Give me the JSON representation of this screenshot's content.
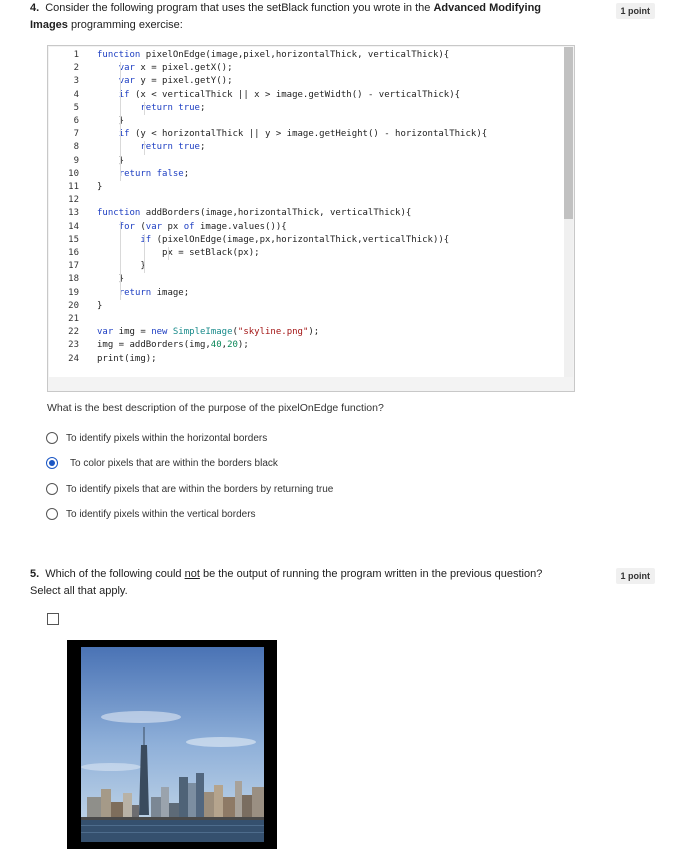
{
  "q4": {
    "number": "4.",
    "text_a": "Consider the following program that uses the setBlack function you wrote in the ",
    "text_bold": "Advanced Modifying Images",
    "text_b": " programming exercise:",
    "points": "1 point",
    "prompt": "What is the best description of the purpose of the pixelOnEdge function?",
    "options": [
      {
        "label": "To identify pixels within the horizontal borders",
        "selected": false
      },
      {
        "label": "To color pixels that are within the borders black",
        "selected": true
      },
      {
        "label": "To identify pixels that are within the borders by returning true",
        "selected": false
      },
      {
        "label": "To identify pixels within the vertical borders",
        "selected": false
      }
    ]
  },
  "code_lines": [
    {
      "n": "1",
      "t": "function pixelOnEdge(image,pixel,horizontalThick, verticalThick){"
    },
    {
      "n": "2",
      "t": "    var x = pixel.getX();"
    },
    {
      "n": "3",
      "t": "    var y = pixel.getY();"
    },
    {
      "n": "4",
      "t": "    if (x < verticalThick || x > image.getWidth() - verticalThick){"
    },
    {
      "n": "5",
      "t": "        return true;"
    },
    {
      "n": "6",
      "t": "    }"
    },
    {
      "n": "7",
      "t": "    if (y < horizontalThick || y > image.getHeight() - horizontalThick){"
    },
    {
      "n": "8",
      "t": "        return true;"
    },
    {
      "n": "9",
      "t": "    }"
    },
    {
      "n": "10",
      "t": "    return false;"
    },
    {
      "n": "11",
      "t": "}"
    },
    {
      "n": "12",
      "t": ""
    },
    {
      "n": "13",
      "t": "function addBorders(image,horizontalThick, verticalThick){"
    },
    {
      "n": "14",
      "t": "    for (var px of image.values()){"
    },
    {
      "n": "15",
      "t": "        if (pixelOnEdge(image,px,horizontalThick,verticalThick)){"
    },
    {
      "n": "16",
      "t": "            px = setBlack(px);"
    },
    {
      "n": "17",
      "t": "        }"
    },
    {
      "n": "18",
      "t": "    }"
    },
    {
      "n": "19",
      "t": "    return image;"
    },
    {
      "n": "20",
      "t": "}"
    },
    {
      "n": "21",
      "t": ""
    },
    {
      "n": "22",
      "t": "var img = new SimpleImage(\"skyline.png\");"
    },
    {
      "n": "23",
      "t": "img = addBorders(img,40,20);"
    },
    {
      "n": "24",
      "t": "print(img);"
    }
  ],
  "q5": {
    "number": "5.",
    "text_a": "Which of the following could ",
    "text_u": "not",
    "text_b": " be the output of running the program written in the previous question? Select all that apply.",
    "points": "1 point"
  },
  "colors": {
    "accent": "#1a56c4",
    "keyword": "#1d3ec2",
    "class": "#188a8a",
    "string": "#a31515",
    "number": "#098658"
  }
}
